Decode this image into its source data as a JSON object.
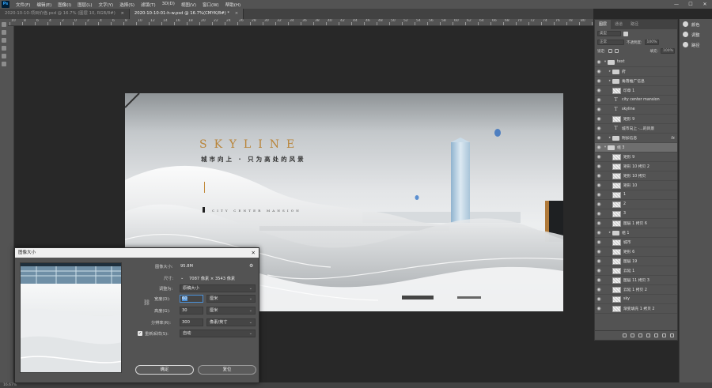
{
  "menubar": {
    "app_icon": "Ps",
    "items": [
      "文件(F)",
      "编辑(E)",
      "图像(I)",
      "图层(L)",
      "文字(Y)",
      "选择(S)",
      "滤镜(T)",
      "3D(D)",
      "视图(V)",
      "窗口(W)",
      "帮助(H)"
    ],
    "window_controls": [
      "—",
      "☐",
      "✕"
    ]
  },
  "tabs": [
    {
      "label": "2020-10-10-项目价值.psd @ 16.7% (图层 10, RGB/8#)",
      "close": "×"
    },
    {
      "label": "2020-10-10-01-h-w.psd @ 16.7%(CMYK/8#) *",
      "close": "×"
    }
  ],
  "ruler": {
    "labels": [
      "10",
      "8",
      "6",
      "4",
      "2",
      "0",
      "2",
      "4",
      "6",
      "8",
      "10",
      "12",
      "14",
      "16",
      "18",
      "20",
      "22",
      "24",
      "26",
      "28",
      "30",
      "32",
      "34",
      "36",
      "38",
      "40",
      "42",
      "44",
      "46",
      "48",
      "50",
      "52",
      "54",
      "56",
      "58",
      "60",
      "62",
      "64",
      "66",
      "68",
      "70",
      "72",
      "74",
      "76",
      "78",
      "80",
      "82"
    ]
  },
  "artwork": {
    "title": "SKYLINE",
    "subtitle": "城市向上 · 只为高处的风景",
    "tagline": "CITY CENTER MANSION",
    "colors": {
      "gold": "#b9853a",
      "sky_top": "#8e9396",
      "sky_mid": "#e3e5e7"
    }
  },
  "panels_strip": [
    {
      "icon": "color-icon",
      "label": "颜色"
    },
    {
      "icon": "adjust-icon",
      "label": "调整"
    },
    {
      "icon": "path-icon",
      "label": "路径"
    }
  ],
  "layers_panel": {
    "tabs": [
      "图层",
      "通道",
      "路径"
    ],
    "kind_filter": "类型",
    "blend_mode": "正常",
    "opacity_label": "不透明度:",
    "opacity_value": "100%",
    "lock_label": "锁定:",
    "fill_label": "填充:",
    "fill_value": "100%",
    "layers": [
      {
        "name": "text",
        "type": "folder",
        "level": 0,
        "expanded": true,
        "selected": false
      },
      {
        "name": "府",
        "type": "folder",
        "level": 1,
        "expanded": false,
        "selected": false
      },
      {
        "name": "角落推广信息",
        "type": "folder",
        "level": 1,
        "expanded": false,
        "selected": false
      },
      {
        "name": "印章 1",
        "type": "image",
        "level": 1,
        "selected": false
      },
      {
        "name": "city center mansion",
        "type": "text",
        "level": 1,
        "selected": false
      },
      {
        "name": "skyline",
        "type": "text",
        "level": 1,
        "selected": false
      },
      {
        "name": "矩形 9",
        "type": "image",
        "level": 1,
        "selected": false
      },
      {
        "name": "城市向上 ·...的风景",
        "type": "text",
        "level": 1,
        "selected": false
      },
      {
        "name": "附加信息",
        "type": "folder",
        "level": 1,
        "expanded": false,
        "selected": false,
        "fx": "fx"
      },
      {
        "name": "组 3",
        "type": "folder",
        "level": 0,
        "expanded": true,
        "selected": true
      },
      {
        "name": "矩形 9",
        "type": "image",
        "level": 1,
        "selected": false
      },
      {
        "name": "矩形 10 拷贝 2",
        "type": "image",
        "level": 1,
        "selected": false
      },
      {
        "name": "矩形 10 拷贝",
        "type": "image",
        "level": 1,
        "selected": false
      },
      {
        "name": "矩形 10",
        "type": "image",
        "level": 1,
        "selected": false
      },
      {
        "name": "1",
        "type": "image",
        "level": 1,
        "selected": false
      },
      {
        "name": "2",
        "type": "image",
        "level": 1,
        "selected": false
      },
      {
        "name": "3",
        "type": "image",
        "level": 1,
        "selected": false
      },
      {
        "name": "图层 1 拷贝 6",
        "type": "image",
        "level": 1,
        "selected": false
      },
      {
        "name": "组 1",
        "type": "folder",
        "level": 1,
        "expanded": false,
        "selected": false
      },
      {
        "name": "城市",
        "type": "image",
        "level": 1,
        "selected": false
      },
      {
        "name": "矩形 6",
        "type": "image",
        "level": 1,
        "selected": false
      },
      {
        "name": "图层 19",
        "type": "image",
        "level": 1,
        "selected": false
      },
      {
        "name": "云延 1",
        "type": "image",
        "level": 1,
        "selected": false
      },
      {
        "name": "图层 11 拷贝 3",
        "type": "image",
        "level": 1,
        "selected": false
      },
      {
        "name": "云延 1 拷贝 2",
        "type": "image",
        "level": 1,
        "selected": false
      },
      {
        "name": "sky",
        "type": "image",
        "level": 1,
        "selected": false
      },
      {
        "name": "渐变填充 1 拷贝 2",
        "type": "image",
        "level": 1,
        "selected": false
      }
    ]
  },
  "statusbar": {
    "zoom": "16.67%"
  },
  "dialog": {
    "title": "图像大小",
    "close": "✕",
    "image_size_label": "图像大小:",
    "image_size_value": "95.8M",
    "dimensions_label": "尺寸:",
    "dimensions_value": "7087 像素 × 3543 像素",
    "fit_to_label": "调整为:",
    "fit_to_value": "原稿大小",
    "width_label": "宽度(D):",
    "width_value": "60",
    "width_unit": "厘米",
    "height_label": "高度(G):",
    "height_value": "30",
    "height_unit": "厘米",
    "resolution_label": "分辨率(R):",
    "resolution_value": "300",
    "resolution_unit": "像素/英寸",
    "resample_label": "重新采样(S):",
    "resample_checked": true,
    "resample_value": "自动",
    "ok_label": "确定",
    "reset_label": "复位"
  }
}
